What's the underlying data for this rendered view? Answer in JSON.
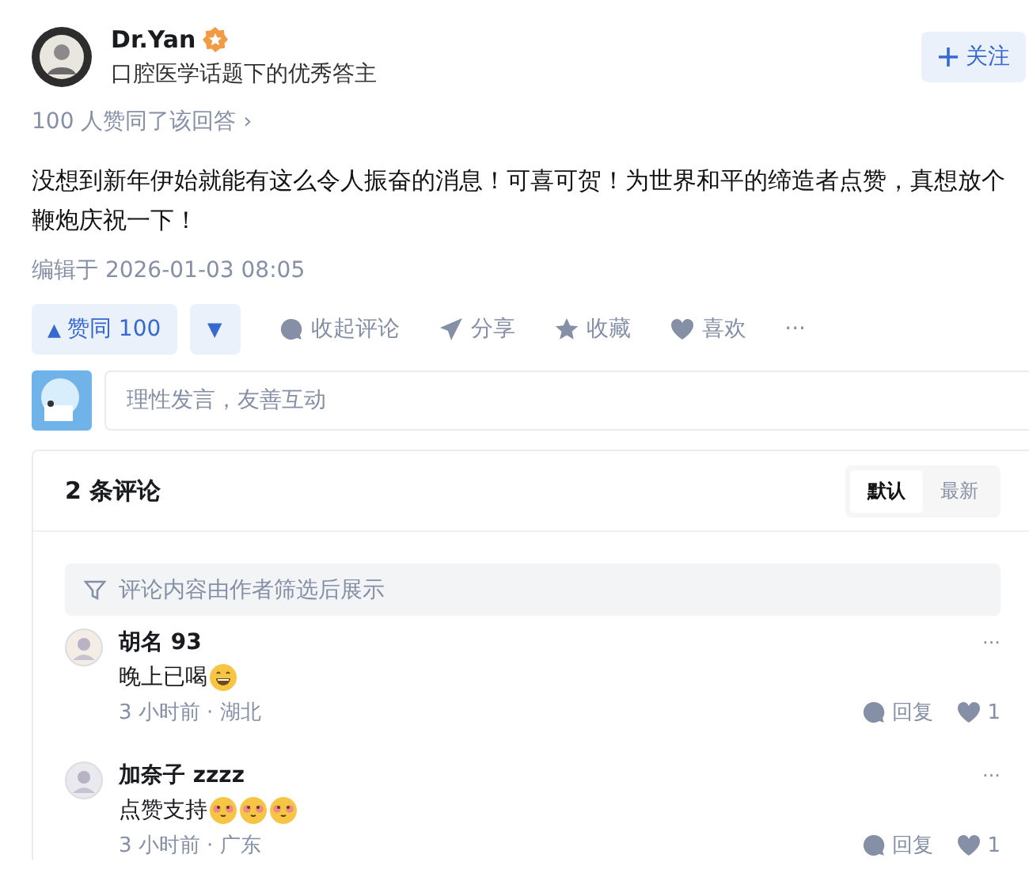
{
  "author": {
    "name": "Dr.Yan",
    "subtitle": "口腔医学话题下的优秀答主",
    "follow_button": "关注"
  },
  "upvote_summary": "100 人赞同了该回答 ›",
  "answer": {
    "text": "没想到新年伊始就能有这么令人振奋的消息！可喜可贺！为世界和平的缔造者点赞，真想放个鞭炮庆祝一下！",
    "edited": "编辑于 2026-01-03 08:05"
  },
  "vote": {
    "up_label": "赞同 100",
    "up_icon": "▲",
    "down_icon": "▼"
  },
  "actions": [
    {
      "kind": "comment",
      "label": "收起评论"
    },
    {
      "kind": "share",
      "label": "分享"
    },
    {
      "kind": "star",
      "label": "收藏"
    },
    {
      "kind": "heart",
      "label": "喜欢"
    },
    {
      "kind": "more",
      "label": "···"
    }
  ],
  "comment_input": {
    "placeholder": "理性发言，友善互动"
  },
  "comments": {
    "count": "2 条评论",
    "sort_tabs": [
      {
        "label": "默认",
        "selected": true
      },
      {
        "label": "最新",
        "selected": false
      }
    ],
    "notice": "评论内容由作者筛选后展示",
    "items": [
      {
        "name": "胡名 93",
        "text": "晚上已喝",
        "emojis": [
          {
            "kind": "grin"
          }
        ],
        "meta": "3 小时前 · 湖北",
        "reply": "回复",
        "likes": "1",
        "more": "···"
      },
      {
        "name": "加奈子 zzzz",
        "text": "点赞支持",
        "emojis": [
          {
            "kind": "blush"
          },
          {
            "kind": "blush"
          },
          {
            "kind": "blush"
          }
        ],
        "meta": "3 小时前 · 广东",
        "reply": "回复",
        "likes": "1",
        "more": "···"
      }
    ]
  }
}
